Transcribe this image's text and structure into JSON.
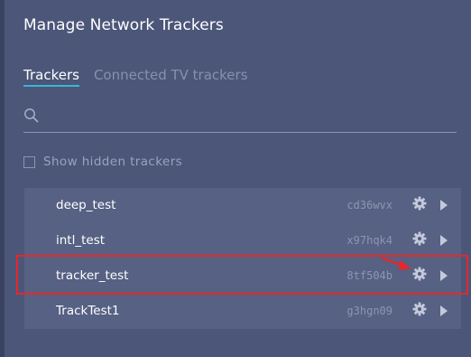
{
  "dialog": {
    "title": "Manage Network Trackers"
  },
  "tabs": [
    {
      "label": "Trackers",
      "active": true
    },
    {
      "label": "Connected TV trackers",
      "active": false
    }
  ],
  "search": {
    "value": "",
    "placeholder": "",
    "icon": "search-icon"
  },
  "hidden_toggle": {
    "label": "Show hidden trackers",
    "checked": false
  },
  "trackers": [
    {
      "name": "deep_test",
      "id": "cd36wvx"
    },
    {
      "name": "intl_test",
      "id": "x97hqk4"
    },
    {
      "name": "tracker_test",
      "id": "8tf504b"
    },
    {
      "name": "TrackTest1",
      "id": "g3hgn09"
    }
  ],
  "row_icons": {
    "settings": "gear-icon",
    "expand": "chevron-right-icon"
  },
  "colors": {
    "background": "#4b5679",
    "list_background": "#566183",
    "tab_underline": "#3bb4d9",
    "highlight": "#e8262b"
  }
}
